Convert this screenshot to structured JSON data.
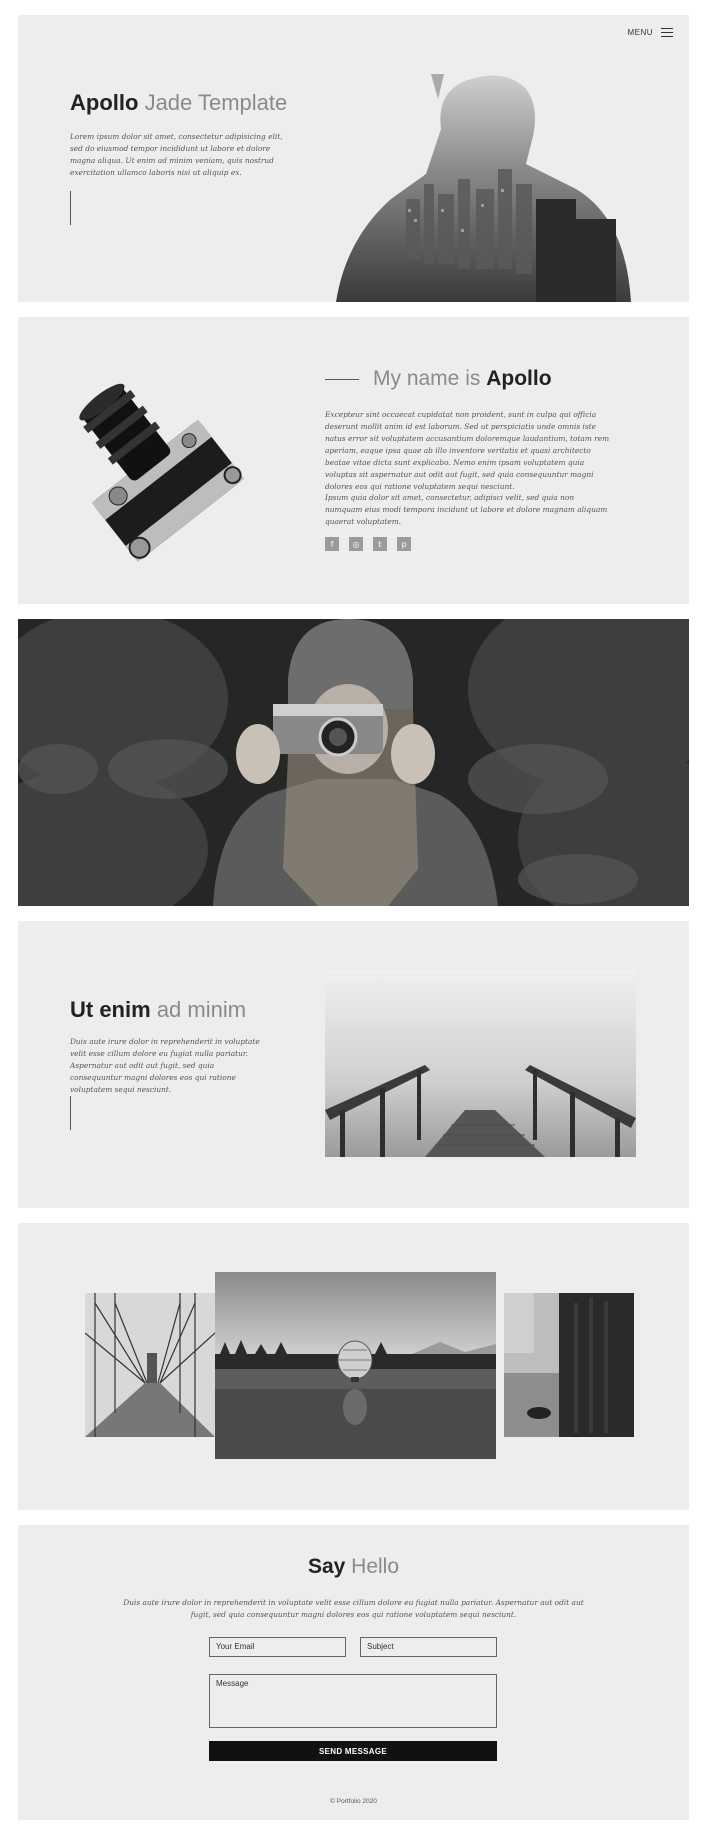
{
  "nav": {
    "menu_label": "MENU"
  },
  "hero": {
    "title_bold": "Apollo",
    "title_light": "Jade Template",
    "text": "Lorem ipsum dolor sit amet, consectetur adipisicing elit, sed do eiusmod tempor incididunt ut labore et dolore magna aliqua. Ut enim ad minim veniam, quis nostrud exercitation ullamco laboris nisi ut aliquip ex."
  },
  "about": {
    "heading_light": "My name is",
    "heading_bold": "Apollo",
    "paragraph1": "Excepteur sint occaecat cupidatat non proident, sunt in culpa qui officia deserunt mollit anim id est laborum. Sed ut perspiciatis unde omnis iste natus error sit voluptatem accusantium doloremque laudantium, totam rem aperiam, eaque ipsa quae ab illo inventore veritatis et quasi architecto beatae vitae dicta sunt explicabo. Nemo enim ipsam voluptatem quia voluptas sit aspernatur aut odit aut fugit, sed quia consequuntur magni dolores eos qui ratione voluptatem sequi nesciunt.",
    "paragraph2": "Ipsum quia dolor sit amet, consectetur, adipisci velit, sed quia non numquam eius modi tempora incidunt ut labore et dolore magnam aliquam quaerat voluptatem.",
    "socials": [
      {
        "icon": "facebook-icon",
        "glyph": "f"
      },
      {
        "icon": "instagram-icon",
        "glyph": "◎"
      },
      {
        "icon": "twitter-icon",
        "glyph": "t"
      },
      {
        "icon": "pinterest-icon",
        "glyph": "p"
      }
    ]
  },
  "feature": {
    "title_bold": "Ut enim",
    "title_light": "ad minim",
    "text": "Duis aute irure dolor in reprehenderit in voluptate velit esse cillum dolore eu fugiat nulla pariatur. Aspernatur aut odit aut fugit, sed quia consequuntur magni dolores eos qui ratione voluptatem sequi nesciunt."
  },
  "contact": {
    "title_bold": "Say",
    "title_light": "Hello",
    "text": "Duis aute irure dolor in reprehenderit in voluptate velit esse cillum dolore eu fugiat nulla pariatur. Aspernatur aut odit aut fugit, sed quia consequuntur magni dolores eos qui ratione voluptatem sequi nesciunt.",
    "email_placeholder": "Your Email",
    "subject_placeholder": "Subject",
    "message_placeholder": "Message",
    "send_label": "SEND MESSAGE",
    "copyright": "© Portfolio 2020"
  },
  "colors": {
    "section_bg": "#ededed",
    "page_bg": "#ffffff",
    "button_bg": "#111111",
    "text_dark": "#222222"
  }
}
